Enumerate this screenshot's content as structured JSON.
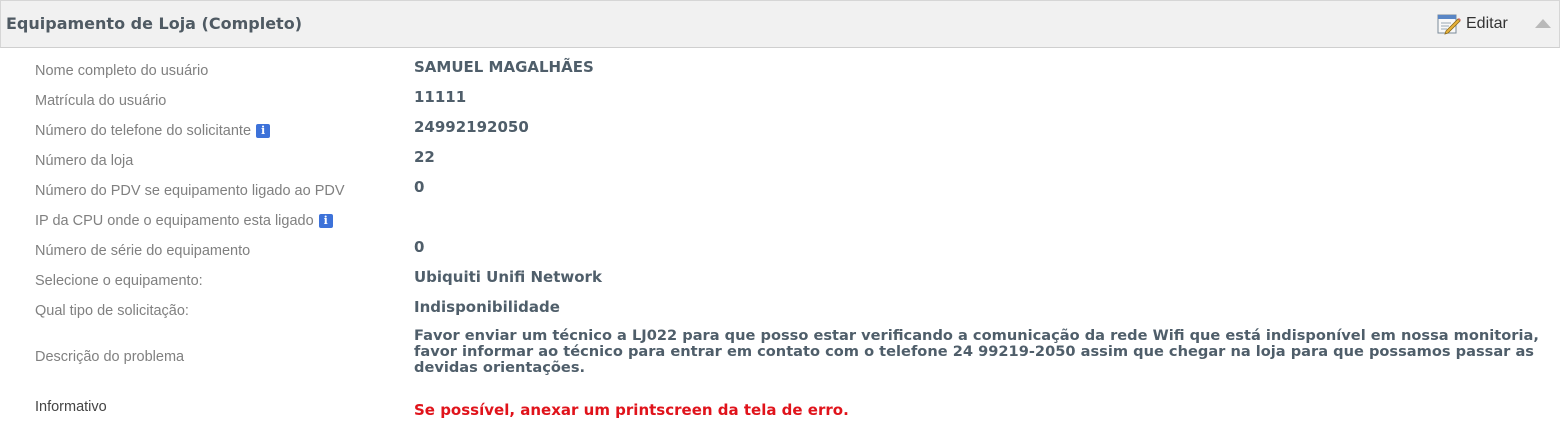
{
  "header": {
    "title": "Equipamento de Loja (Completo)",
    "edit_label": "Editar"
  },
  "fields": [
    {
      "label": "Nome completo do usuário",
      "value": "SAMUEL MAGALHÃES"
    },
    {
      "label": "Matrícula do usuário",
      "value": "11111"
    },
    {
      "label": "Número do telefone do solicitante",
      "value": "24992192050",
      "info": "i"
    },
    {
      "label": "Número da loja",
      "value": "22"
    },
    {
      "label": "Número do PDV se equipamento ligado ao PDV",
      "value": "0"
    },
    {
      "label": "IP da CPU onde o equipamento esta ligado",
      "value": "",
      "info": "i"
    },
    {
      "label": "Número de série do equipamento",
      "value": "0"
    },
    {
      "label": "Selecione o equipamento:",
      "value": "Ubiquiti Unifi Network"
    },
    {
      "label": "Qual tipo de solicitação:",
      "value": "Indisponibilidade"
    },
    {
      "label": "Descrição do problema",
      "value": "Favor enviar um técnico a LJ022 para que posso estar verificando a comunicação da rede Wifi que está indisponível em nossa monitoria, favor informar ao técnico para entrar em contato com o telefone 24 99219-2050 assim que chegar na loja para que possamos passar as devidas orientações."
    },
    {
      "label": "Informativo",
      "value": "Se possível, anexar um printscreen da tela de erro."
    }
  ],
  "colors": {
    "value_text": "#4f5e6a",
    "warning_text": "#e0131b",
    "info_badge": "#3d72d9"
  },
  "icons": {
    "edit": "edit-note-pencil-icon",
    "collapse": "collapse-arrow-up-icon",
    "info": "info-icon"
  }
}
